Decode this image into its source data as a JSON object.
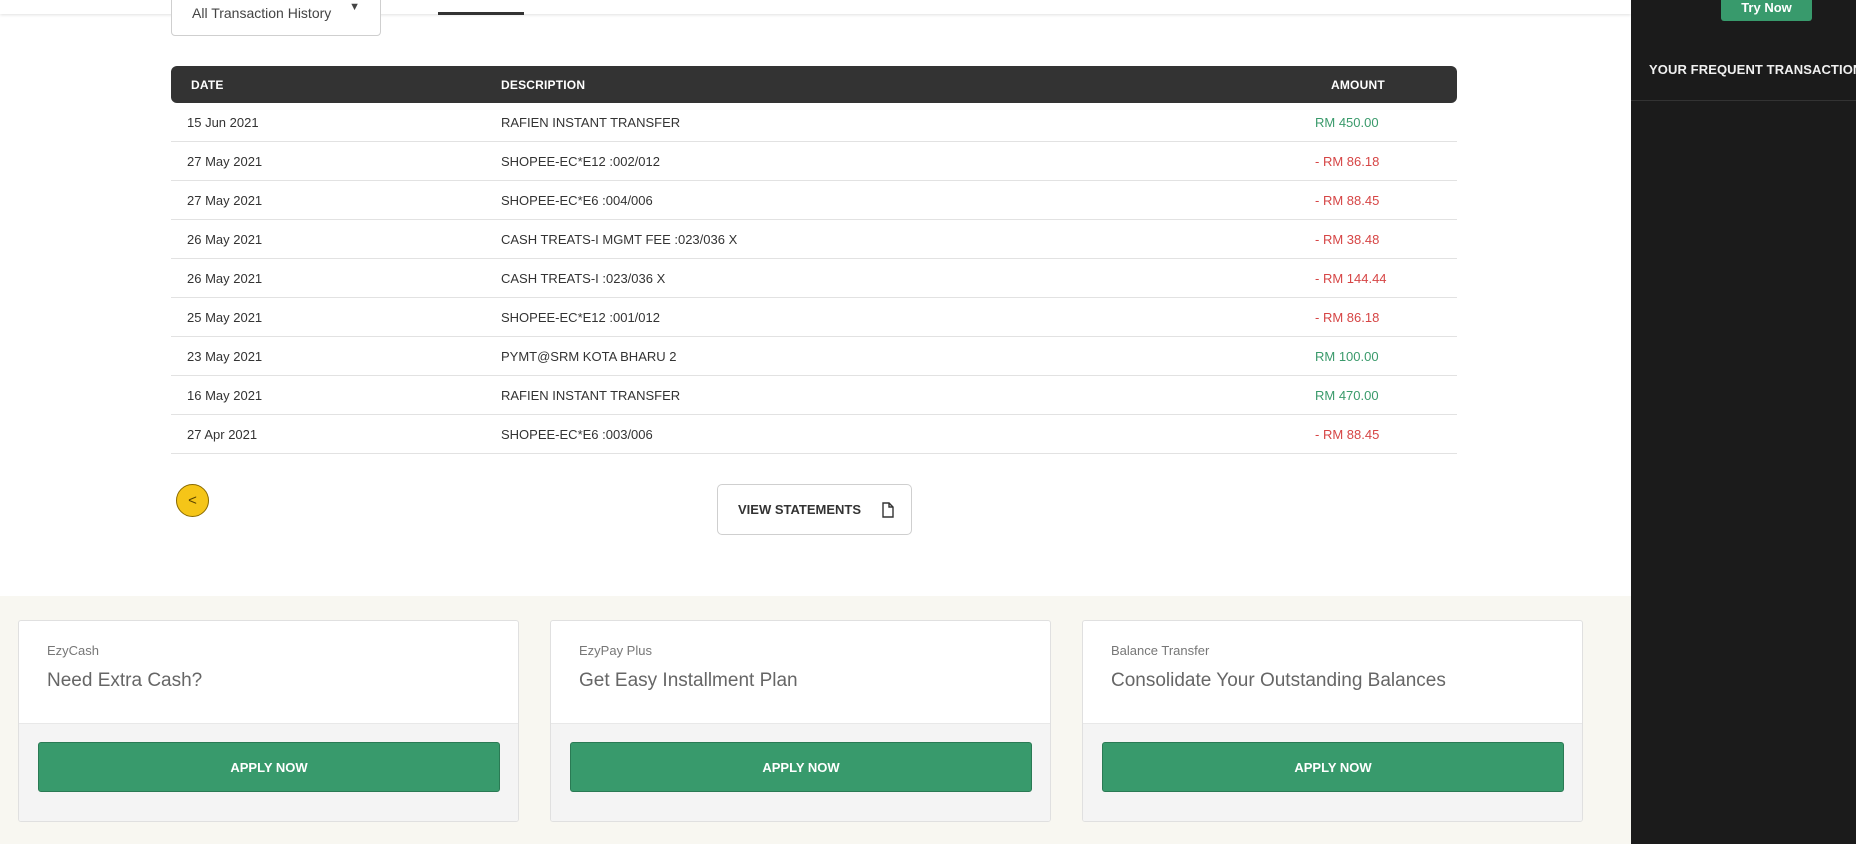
{
  "filter": {
    "selected": "All Transaction History"
  },
  "table": {
    "headers": {
      "date": "DATE",
      "description": "DESCRIPTION",
      "amount": "AMOUNT"
    },
    "rows": [
      {
        "date": "15 Jun 2021",
        "description": "RAFIEN INSTANT TRANSFER",
        "amount": "RM 450.00",
        "type": "credit"
      },
      {
        "date": "27 May 2021",
        "description": "SHOPEE-EC*E12 :002/012",
        "amount": "- RM 86.18",
        "type": "debit"
      },
      {
        "date": "27 May 2021",
        "description": "SHOPEE-EC*E6 :004/006",
        "amount": "- RM 88.45",
        "type": "debit"
      },
      {
        "date": "26 May 2021",
        "description": "CASH TREATS-I MGMT FEE :023/036 X",
        "amount": "- RM 38.48",
        "type": "debit"
      },
      {
        "date": "26 May 2021",
        "description": "CASH TREATS-I :023/036 X",
        "amount": "- RM 144.44",
        "type": "debit"
      },
      {
        "date": "25 May 2021",
        "description": "SHOPEE-EC*E12 :001/012",
        "amount": "- RM 86.18",
        "type": "debit"
      },
      {
        "date": "23 May 2021",
        "description": "PYMT@SRM KOTA BHARU 2",
        "amount": "RM 100.00",
        "type": "credit"
      },
      {
        "date": "16 May 2021",
        "description": "RAFIEN INSTANT TRANSFER",
        "amount": "RM 470.00",
        "type": "credit"
      },
      {
        "date": "27 Apr 2021",
        "description": "SHOPEE-EC*E6 :003/006",
        "amount": "- RM 88.45",
        "type": "debit"
      }
    ]
  },
  "actions": {
    "back_glyph": "<",
    "view_statements": "VIEW STATEMENTS"
  },
  "promos": [
    {
      "kicker": "EzyCash",
      "title": "Need Extra Cash?",
      "button": "APPLY NOW"
    },
    {
      "kicker": "EzyPay Plus",
      "title": "Get Easy Installment Plan",
      "button": "APPLY NOW"
    },
    {
      "kicker": "Balance Transfer",
      "title": "Consolidate Your Outstanding Balances",
      "button": "APPLY NOW"
    }
  ],
  "sidebar": {
    "try_button": "Try Now",
    "frequent_title": "YOUR FREQUENT TRANSACTIONS"
  },
  "colors": {
    "credit": "#3a9a6b",
    "debit": "#d64545",
    "accent_green": "#389a6c",
    "back_button": "#f5c518",
    "sidebar_bg": "#1b1b1b",
    "table_head": "#333333"
  }
}
